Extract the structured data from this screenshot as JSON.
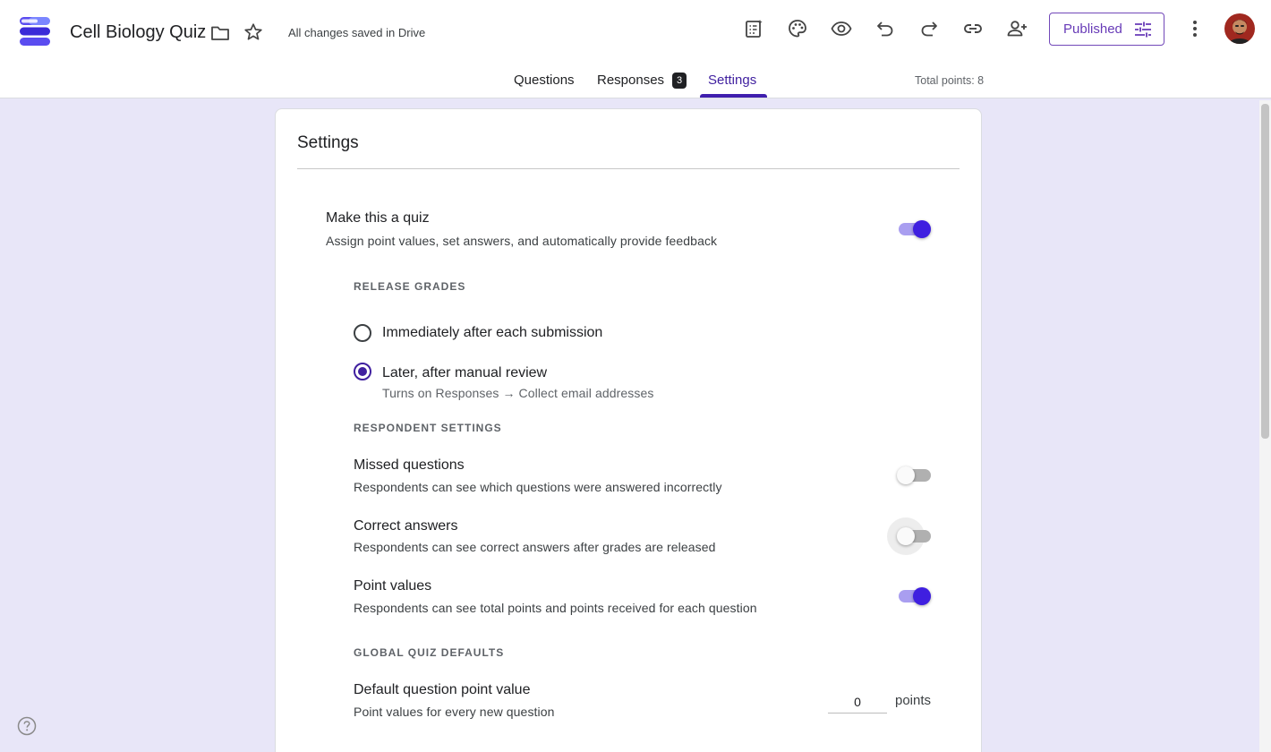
{
  "app": {
    "title": "Cell Biology Quiz",
    "save_status": "All changes saved in Drive",
    "publish_label": "Published"
  },
  "toolbar_icons": [
    "customize-quiz-icon",
    "palette-icon",
    "preview-eye-icon",
    "undo-icon",
    "redo-icon",
    "link-icon",
    "add-collaborator-icon",
    "tune-icon",
    "more-vert-icon"
  ],
  "tabs": [
    {
      "label": "Questions",
      "active": false
    },
    {
      "label": "Responses",
      "active": false,
      "badge": "3"
    },
    {
      "label": "Settings",
      "active": true
    }
  ],
  "total_points": "Total points: 8",
  "settings": {
    "title": "Settings",
    "quiz": {
      "title": "Make this a quiz",
      "subtitle": "Assign point values, set answers, and automatically provide feedback",
      "enabled": true
    },
    "release_grades": {
      "label": "RELEASE GRADES",
      "options": [
        {
          "label": "Immediately after each submission",
          "selected": false
        },
        {
          "label": "Later, after manual review",
          "selected": true,
          "note": "Turns on Responses → Collect email addresses"
        }
      ]
    },
    "respondent_settings": {
      "label": "RESPONDENT SETTINGS",
      "items": [
        {
          "title": "Missed questions",
          "subtitle": "Respondents can see which questions were answered incorrectly",
          "enabled": false
        },
        {
          "title": "Correct answers",
          "subtitle": "Respondents can see correct answers after grades are released",
          "enabled": false
        },
        {
          "title": "Point values",
          "subtitle": "Respondents can see total points and points received for each question",
          "enabled": true
        }
      ]
    },
    "global_defaults": {
      "label": "GLOBAL QUIZ DEFAULTS",
      "default_points": {
        "title": "Default question point value",
        "subtitle": "Point values for every new question",
        "value": "0",
        "unit": "points"
      }
    }
  },
  "colors": {
    "accent": "#3f1fe0",
    "brand_purple": "#673ab7",
    "page_background": "#e8e6f8"
  }
}
